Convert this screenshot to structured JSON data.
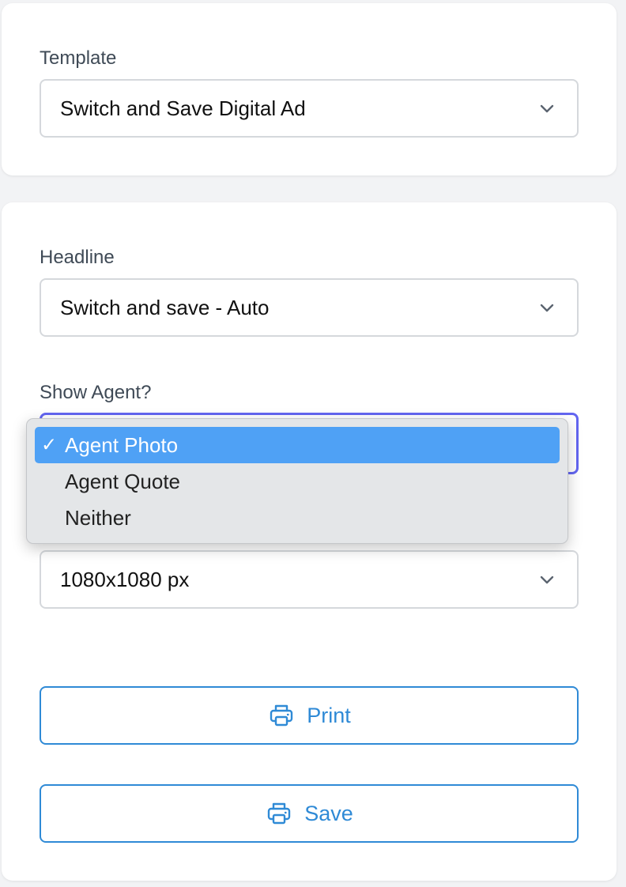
{
  "template_card": {
    "label": "Template",
    "selected": "Switch and Save Digital Ad"
  },
  "main_card": {
    "headline_label": "Headline",
    "headline_selected": "Switch and save - Auto",
    "show_agent_label": "Show Agent?",
    "size_selected": "1080x1080 px",
    "print_label": "Print",
    "save_label": "Save"
  },
  "agent_dropdown": {
    "options": [
      "Agent Photo",
      "Agent Quote",
      "Neither"
    ],
    "selected_index": 0,
    "check_glyph": "✓"
  },
  "colors": {
    "accent": "#2f8ad6",
    "focus_ring": "#6366f1",
    "selected_option": "#4fa1f5"
  },
  "icons": {
    "chevron": "chevron-down-icon",
    "printer": "printer-icon"
  }
}
